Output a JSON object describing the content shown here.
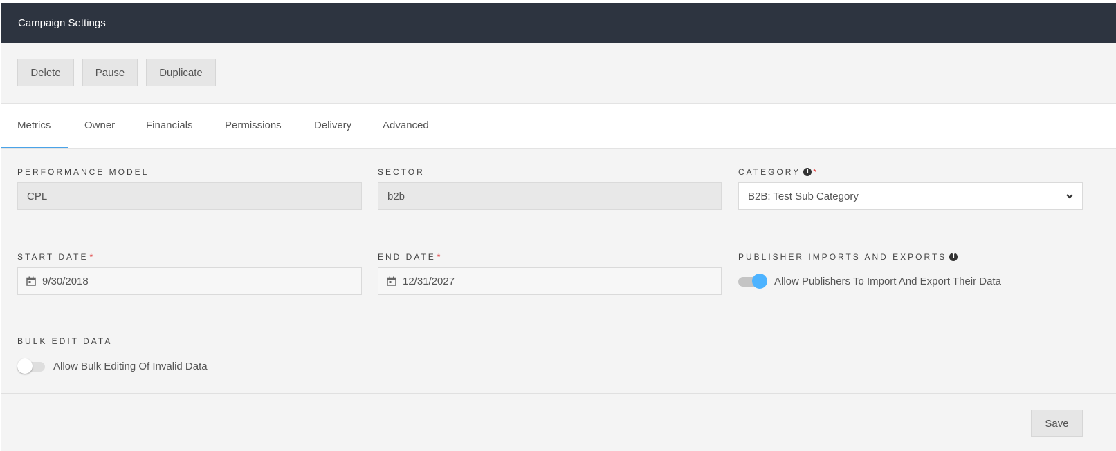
{
  "header": {
    "title": "Campaign Settings"
  },
  "toolbar": {
    "delete_label": "Delete",
    "pause_label": "Pause",
    "duplicate_label": "Duplicate"
  },
  "tabs": [
    {
      "label": "Metrics",
      "active": true
    },
    {
      "label": "Owner",
      "active": false
    },
    {
      "label": "Financials",
      "active": false
    },
    {
      "label": "Permissions",
      "active": false
    },
    {
      "label": "Delivery",
      "active": false
    },
    {
      "label": "Advanced",
      "active": false
    }
  ],
  "fields": {
    "performance_model": {
      "label": "PERFORMANCE MODEL",
      "value": "CPL"
    },
    "sector": {
      "label": "SECTOR",
      "value": "b2b"
    },
    "category": {
      "label": "CATEGORY",
      "required_mark": "*",
      "value": "B2B: Test Sub Category",
      "icon": "info-icon"
    },
    "start_date": {
      "label": "START DATE",
      "required_mark": "*",
      "value": "9/30/2018",
      "icon": "calendar-icon"
    },
    "end_date": {
      "label": "END DATE",
      "required_mark": "*",
      "value": "12/31/2027",
      "icon": "calendar-icon"
    },
    "publisher_imports_exports": {
      "label": "PUBLISHER IMPORTS AND EXPORTS",
      "toggle_label": "Allow Publishers To Import And Export Their Data",
      "enabled": true,
      "icon": "info-icon"
    },
    "bulk_edit": {
      "label": "BULK EDIT DATA",
      "toggle_label": "Allow Bulk Editing Of Invalid Data",
      "enabled": false
    }
  },
  "footer": {
    "save_label": "Save"
  },
  "colors": {
    "header_bg": "#2d3440",
    "accent": "#4aa3e8",
    "toggle_on": "#4db3ff",
    "required": "#e03c3c",
    "panel_bg": "#f4f4f4"
  }
}
